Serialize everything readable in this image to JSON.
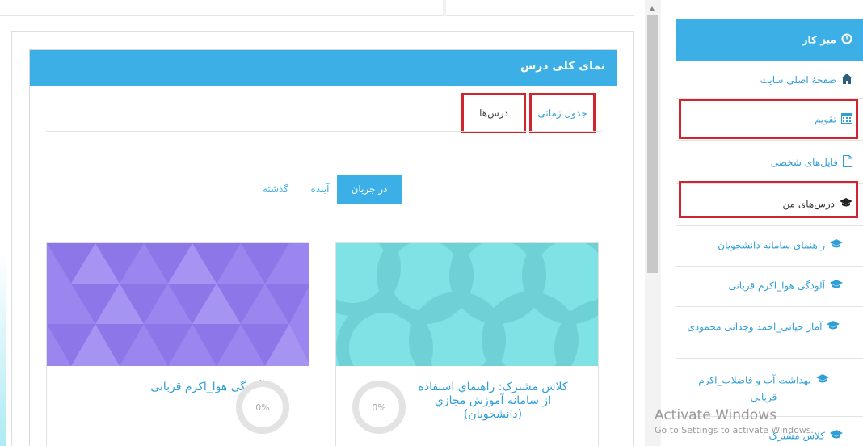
{
  "card": {
    "title": "نمای کلی درس"
  },
  "tabs": {
    "timeline": "جدول زمانی",
    "courses": "درس‌ها"
  },
  "filters": {
    "current": "در جریان",
    "future": "آینده",
    "past": "گذشته"
  },
  "courses": [
    {
      "name": "کلاس مشترک: راهنماي استفاده از سامانه آموزش مجازي (دانشجويان)",
      "progress": "0%",
      "image_color": "#7fe3e6"
    },
    {
      "name": "آلودگی هوا_اکرم قربانی",
      "progress": "0%",
      "image_color": "#9b86f0"
    }
  ],
  "sidebar": {
    "dashboard": "میز کار",
    "home": "صفحهٔ اصلی سایت",
    "calendar": "تقویم",
    "files": "فایل‌های شخصی",
    "my_courses": "درس‌های من",
    "course_items": [
      "راهنمای سامانه دانشجویان",
      "آلودگی هوا_اکرم قربانی",
      "آمار حیاتی_احمد وجدانی محمودی",
      "بهداشت آب و فاضلاب_اکرم قربانی",
      "کلاس مشترک"
    ]
  },
  "watermark": {
    "line1": "Activate Windows",
    "line2": "Go to Settings to activate Windows."
  },
  "colors": {
    "accent": "#3cb0e6",
    "highlight": "#d1242f"
  }
}
